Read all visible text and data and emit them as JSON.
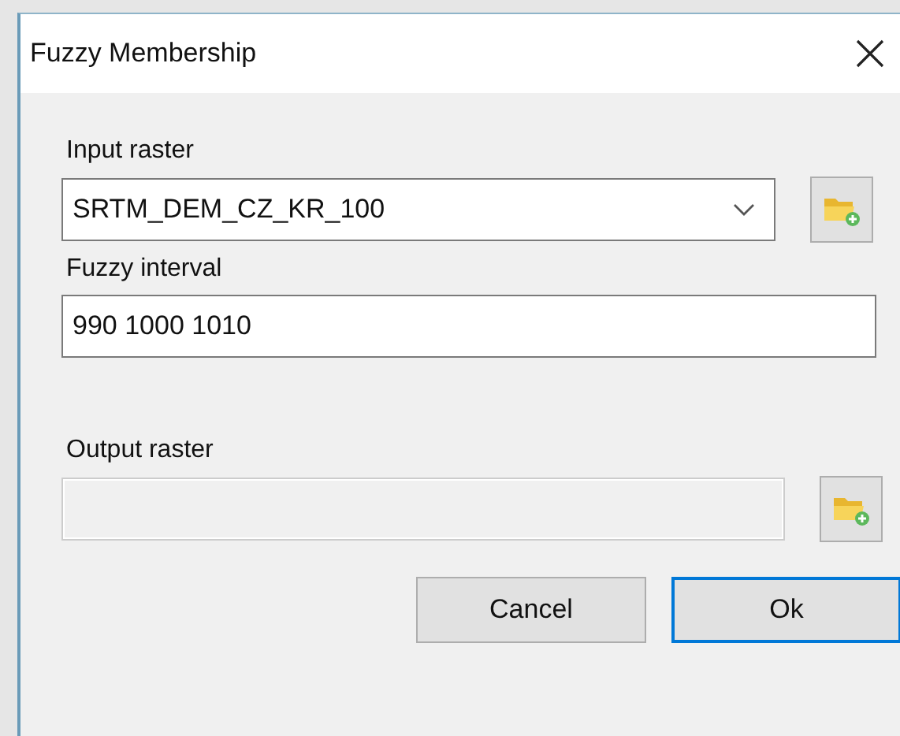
{
  "window": {
    "title": "Fuzzy Membership"
  },
  "fields": [
    {
      "label": "Input raster",
      "kind": "combo",
      "value": "SRTM_DEM_CZ_KR_100",
      "disabled": false,
      "browse": true
    },
    {
      "label": "Fuzzy interval",
      "kind": "text",
      "value": "990 1000 1010",
      "disabled": false,
      "browse": false
    },
    {
      "label": "Output raster",
      "kind": "text",
      "disabled": true,
      "browse": true
    }
  ],
  "buttons": [
    {
      "label": "Cancel",
      "focused": false
    },
    {
      "label": "Ok",
      "focused": true
    }
  ]
}
